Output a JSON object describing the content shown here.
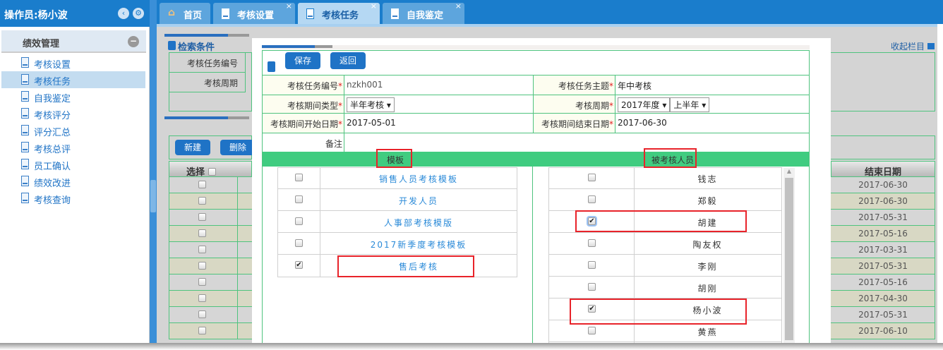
{
  "sidebar": {
    "operator": "操作员:杨小波",
    "section": "绩效管理",
    "items": [
      {
        "label": "考核设置",
        "active": false
      },
      {
        "label": "考核任务",
        "active": true
      },
      {
        "label": "自我鉴定",
        "active": false
      },
      {
        "label": "考核评分",
        "active": false
      },
      {
        "label": "评分汇总",
        "active": false
      },
      {
        "label": "考核总评",
        "active": false
      },
      {
        "label": "员工确认",
        "active": false
      },
      {
        "label": "绩效改进",
        "active": false
      },
      {
        "label": "考核查询",
        "active": false
      }
    ]
  },
  "tabs": [
    {
      "label": "首页",
      "closable": false
    },
    {
      "label": "考核设置",
      "closable": true
    },
    {
      "label": "考核任务",
      "closable": true,
      "active": true
    },
    {
      "label": "自我鉴定",
      "closable": true
    }
  ],
  "background": {
    "search_title": "检索条件",
    "collapse_label": "收起栏目",
    "fields": [
      "考核任务编号",
      "考核周期"
    ],
    "new_label": "新建",
    "delete_label": "删除",
    "select_header": "选择",
    "end_date_header": "结束日期",
    "end_dates": [
      "2017-06-30",
      "2017-06-30",
      "2017-05-31",
      "2017-05-16",
      "2017-03-31",
      "2017-05-31",
      "2017-05-16",
      "2017-04-30",
      "2017-05-31",
      "2017-06-10"
    ]
  },
  "form": {
    "save_label": "保存",
    "back_label": "返回",
    "task_no_label": "考核任务编号",
    "task_no": "nzkh001",
    "topic_label": "考核任务主题",
    "topic": "年中考核",
    "period_type_label": "考核期间类型",
    "period_type": "半年考核",
    "period_label": "考核周期",
    "period_year": "2017年度",
    "period_half": "上半年",
    "start_label": "考核期间开始日期",
    "start": "2017-05-01",
    "end_label": "考核期间结束日期",
    "end": "2017-06-30",
    "remark_label": "备注",
    "template_header": "模板",
    "people_header": "被考核人员",
    "templates": [
      {
        "name": "销售人员考核模板",
        "checked": false
      },
      {
        "name": "开发人员",
        "checked": false
      },
      {
        "name": "人事部考核模版",
        "checked": false
      },
      {
        "name": "2017新季度考核模板",
        "checked": false
      },
      {
        "name": "售后考核",
        "checked": true
      }
    ],
    "people": [
      {
        "name": "钱志",
        "checked": false
      },
      {
        "name": "郑毅",
        "checked": false
      },
      {
        "name": "胡建",
        "checked": true
      },
      {
        "name": "陶友权",
        "checked": false
      },
      {
        "name": "李刚",
        "checked": false
      },
      {
        "name": "胡刚",
        "checked": false
      },
      {
        "name": "杨小波",
        "checked": true
      },
      {
        "name": "黄燕",
        "checked": false
      }
    ]
  },
  "colors": {
    "header_blue": "#1a7dcc",
    "green": "#40cc80",
    "highlight": "#e8232a"
  }
}
